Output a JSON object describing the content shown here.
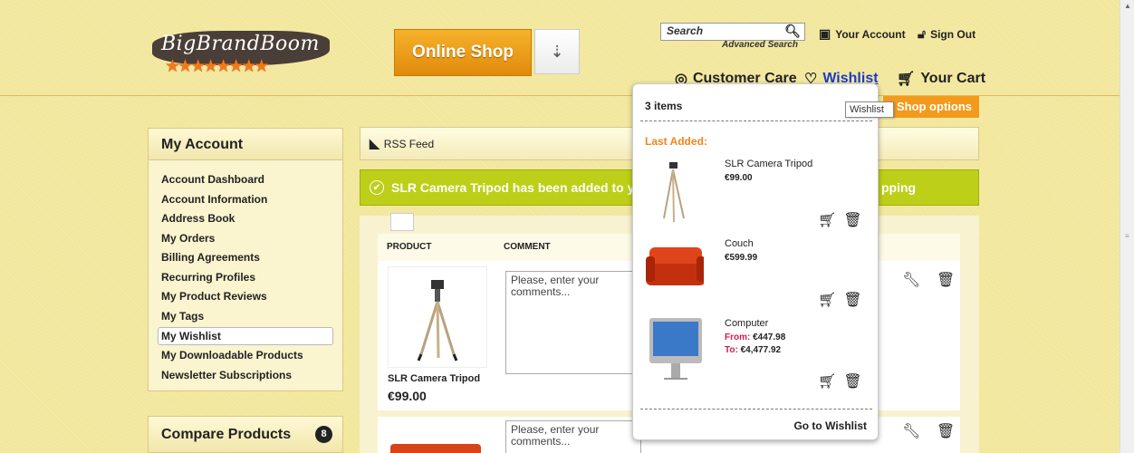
{
  "header": {
    "logo_text": "BigBrandBoom",
    "logo_stars": "★★★★★★★★",
    "online_shop_label": "Online Shop",
    "shop_toggle_icon": "arrow-down",
    "search_placeholder": "Search",
    "advanced_search": "Advanced Search",
    "your_account": "Your Account",
    "sign_out": "Sign Out",
    "customer_care": "Customer Care",
    "wishlist": "Wishlist",
    "your_cart": "Your Cart",
    "shop_options": "Shop options",
    "tooltip": "Wishlist"
  },
  "sidebar": {
    "title": "My Account",
    "items": [
      {
        "label": "Account Dashboard"
      },
      {
        "label": "Account Information"
      },
      {
        "label": "Address Book"
      },
      {
        "label": "My Orders"
      },
      {
        "label": "Billing Agreements"
      },
      {
        "label": "Recurring Profiles"
      },
      {
        "label": "My Product Reviews"
      },
      {
        "label": "My Tags"
      },
      {
        "label": "My Wishlist"
      },
      {
        "label": "My Downloadable Products"
      },
      {
        "label": "Newsletter Subscriptions"
      }
    ],
    "active_index": 8,
    "compare_title": "Compare Products",
    "compare_count": "8"
  },
  "main": {
    "rss_label": "RSS Feed",
    "success_message": "SLR Camera Tripod has been added to y",
    "success_tail": "pping",
    "columns": {
      "product": "PRODUCT",
      "comment": "COMMENT"
    },
    "rows": [
      {
        "name": "SLR Camera Tripod",
        "price": "€99.00",
        "comment_placeholder": "Please, enter your comments..."
      },
      {
        "name": "",
        "price": "",
        "comment_placeholder": "Please, enter your comments..."
      }
    ]
  },
  "wishlist_popup": {
    "count": "3 items",
    "last_added": "Last Added:",
    "items": [
      {
        "name": "SLR Camera Tripod",
        "price": "€99.00"
      },
      {
        "name": "Couch",
        "price": "€599.99"
      },
      {
        "name": "Computer",
        "from_label": "From:",
        "from_price": "€447.98",
        "to_label": "To:",
        "to_price": "€4,477.92"
      }
    ],
    "goto": "Go to Wishlist"
  },
  "colors": {
    "accent": "#f39a1c",
    "success": "#bdcf18",
    "link": "#1a3cc8",
    "price_from": "#cf1e4c"
  }
}
